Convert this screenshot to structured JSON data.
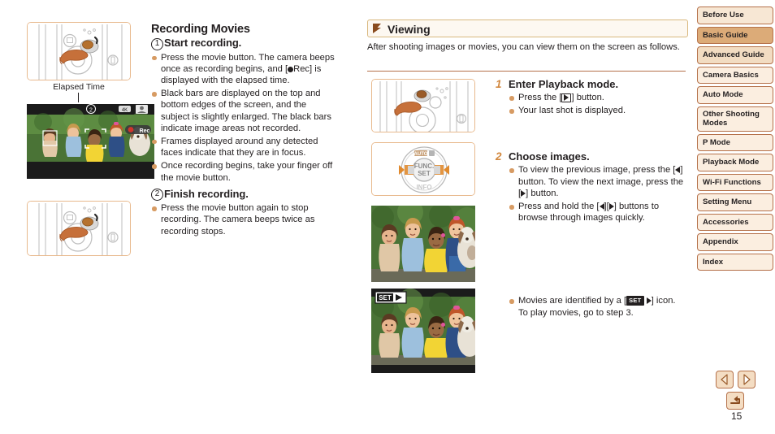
{
  "left_column": {
    "figures": {
      "camera_top": {
        "caption": "Elapsed Time",
        "icon": "camera-movie-button-press-illustration"
      },
      "camera_bottom": {
        "icon": "camera-movie-button-press-illustration"
      },
      "screen_recording": {
        "icon": "recording-screen-photo-four-girls-and-dog",
        "rec_badge": "Rec",
        "step_marker": "2"
      }
    },
    "section_title": "Recording Movies",
    "steps": [
      {
        "number": "1",
        "title": "Start recording.",
        "bullets": [
          "Press the movie button. The camera beeps once as recording begins, and [●Rec] is displayed with the elapsed time.",
          "Black bars are displayed on the top and bottom edges of the screen, and the subject is slightly enlarged. The black bars indicate image areas not recorded.",
          "Frames displayed around any detected faces indicate that they are in focus.",
          "Once recording begins, take your finger off the movie button."
        ]
      },
      {
        "number": "2",
        "title": "Finish recording.",
        "bullets": [
          "Press the movie button again to stop recording. The camera beeps twice as recording stops."
        ]
      }
    ]
  },
  "right_column": {
    "header": {
      "title": "Viewing",
      "icon": "flag-marker-icon"
    },
    "intro": "After shooting images or movies, you can view them on the screen as follows.",
    "figures": {
      "playback_button": {
        "icon": "camera-playback-button-press-illustration"
      },
      "control_dial": {
        "icon": "camera-control-dial-left-right-illustration",
        "center_label": "FUNC. SET",
        "top_label": "AUTO",
        "bottom_label": "INFO"
      },
      "photo_still": {
        "icon": "photo-four-girls-and-dog"
      },
      "photo_movie": {
        "icon": "photo-four-girls-and-dog-with-set-play-overlay",
        "overlay": "SET"
      }
    },
    "steps": [
      {
        "number": "1",
        "title": "Enter Playback mode.",
        "bullets_html": [
          "Press the [<span class=\"boxkey\"><span class=\"tri-r\"></span></span>] button.",
          "Your last shot is displayed."
        ]
      },
      {
        "number": "2",
        "title": "Choose images.",
        "bullets_html": [
          "To view the previous image, press the [<span class=\"tri-l\"></span>] button. To view the next image, press the [<span class=\"tri-r\"></span>] button.",
          "Press and hold the [<span class=\"tri-l\"></span>][<span class=\"tri-r\"></span>] buttons to browse through images quickly."
        ]
      }
    ],
    "movie_note_html": "Movies are identified by a [<span class=\"chip\">SET</span> <span class=\"tri-r\"></span>] icon. To play movies, go to step 3."
  },
  "sidebar": {
    "items": [
      {
        "label": "Before Use",
        "level": "lvl1",
        "selected": false
      },
      {
        "label": "Basic Guide",
        "level": "lvl1",
        "selected": true
      },
      {
        "label": "Advanced Guide",
        "level": "lvl1b",
        "selected": false
      },
      {
        "label": "Camera Basics",
        "level": "lvl2",
        "selected": false
      },
      {
        "label": "Auto Mode",
        "level": "lvl2",
        "selected": false
      },
      {
        "label": "Other Shooting Modes",
        "level": "lvl2",
        "selected": false
      },
      {
        "label": "P Mode",
        "level": "lvl2",
        "selected": false
      },
      {
        "label": "Playback Mode",
        "level": "lvl2",
        "selected": false
      },
      {
        "label": "Wi-Fi Functions",
        "level": "lvl2",
        "selected": false
      },
      {
        "label": "Setting Menu",
        "level": "lvl2",
        "selected": false
      },
      {
        "label": "Accessories",
        "level": "lvl2",
        "selected": false
      },
      {
        "label": "Appendix",
        "level": "lvl2",
        "selected": false
      },
      {
        "label": "Index",
        "level": "lvl2",
        "selected": false
      }
    ]
  },
  "footer": {
    "page_number": "15",
    "nav": {
      "prev": "previous-page-arrow-icon",
      "next": "next-page-arrow-icon",
      "back": "return-back-arrow-icon"
    }
  },
  "colors": {
    "accent_orange": "#d2883f",
    "bullet": "#d79b63",
    "frame_border": "#e8b98d",
    "tab_border": "#b5714a",
    "tab_selected": "#dcab78",
    "rec_red": "#d0342c"
  }
}
